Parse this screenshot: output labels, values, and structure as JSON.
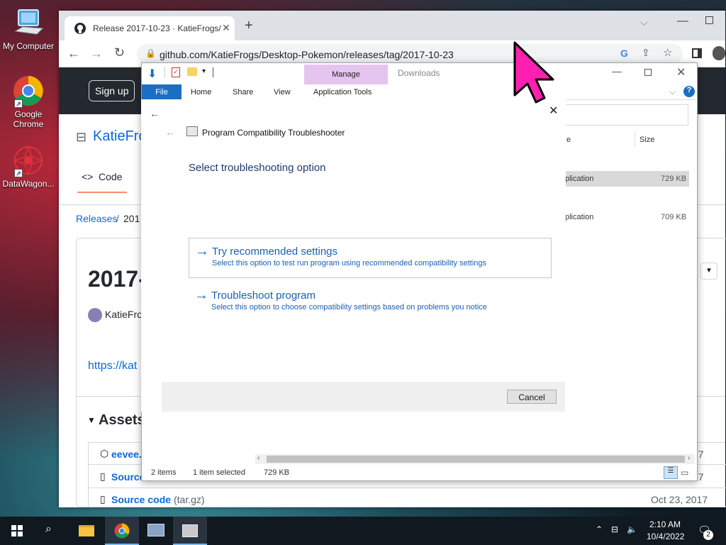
{
  "desktop": {
    "icons": [
      {
        "label": "My Computer",
        "icon": "computer-icon"
      },
      {
        "label": "Google Chrome",
        "icon": "chrome-icon"
      },
      {
        "label": "DataWagon...",
        "icon": "datawagon-icon"
      }
    ]
  },
  "browser": {
    "tab_title": "Release 2017-10-23 · KatieFrogs/",
    "url": "github.com/KatieFrogs/Desktop-Pokemon/releases/tag/2017-10-23",
    "github": {
      "sign_up": "Sign up",
      "repo_owner": "KatieFro",
      "code_tab": "Code",
      "breadcrumb_releases": "Releases",
      "breadcrumb_sep": "/",
      "breadcrumb_tag": "201",
      "release_title": "2017-",
      "author": "KatieFro",
      "link_text": "https://kat",
      "assets_heading": "Assets",
      "assets": [
        {
          "name": "eevee.",
          "suffix": "",
          "date": "17"
        },
        {
          "name": "Source",
          "suffix": "",
          "date": "17"
        },
        {
          "name": "Source code",
          "suffix": "(tar.gz)",
          "date": "Oct 23, 2017"
        }
      ]
    }
  },
  "explorer": {
    "manage_label": "Manage",
    "downloads_label": "Downloads",
    "ribbon_tabs": [
      "File",
      "Home",
      "Share",
      "View",
      "Application Tools"
    ],
    "columns": {
      "name_partial": "e",
      "size": "Size"
    },
    "rows": [
      {
        "type": "plication",
        "size": "729 KB"
      },
      {
        "type": "plication",
        "size": "709 KB"
      }
    ],
    "status": {
      "items": "2 items",
      "selected": "1 item selected",
      "size": "729 KB"
    }
  },
  "troubleshooter": {
    "window_title": "Program Compatibility Troubleshooter",
    "heading": "Select troubleshooting option",
    "options": [
      {
        "title": "Try recommended settings",
        "desc": "Select this option to test run program using recommended compatibility settings"
      },
      {
        "title": "Troubleshoot program",
        "desc": "Select this option to choose compatibility settings based on problems you notice"
      }
    ],
    "cancel": "Cancel"
  },
  "taskbar": {
    "time": "2:10 AM",
    "date": "10/4/2022",
    "notifications": "2"
  },
  "colors": {
    "accent": "#1a6fc4",
    "manage_tab": "#e6c4f0",
    "cursor": "#ff1fb0"
  }
}
